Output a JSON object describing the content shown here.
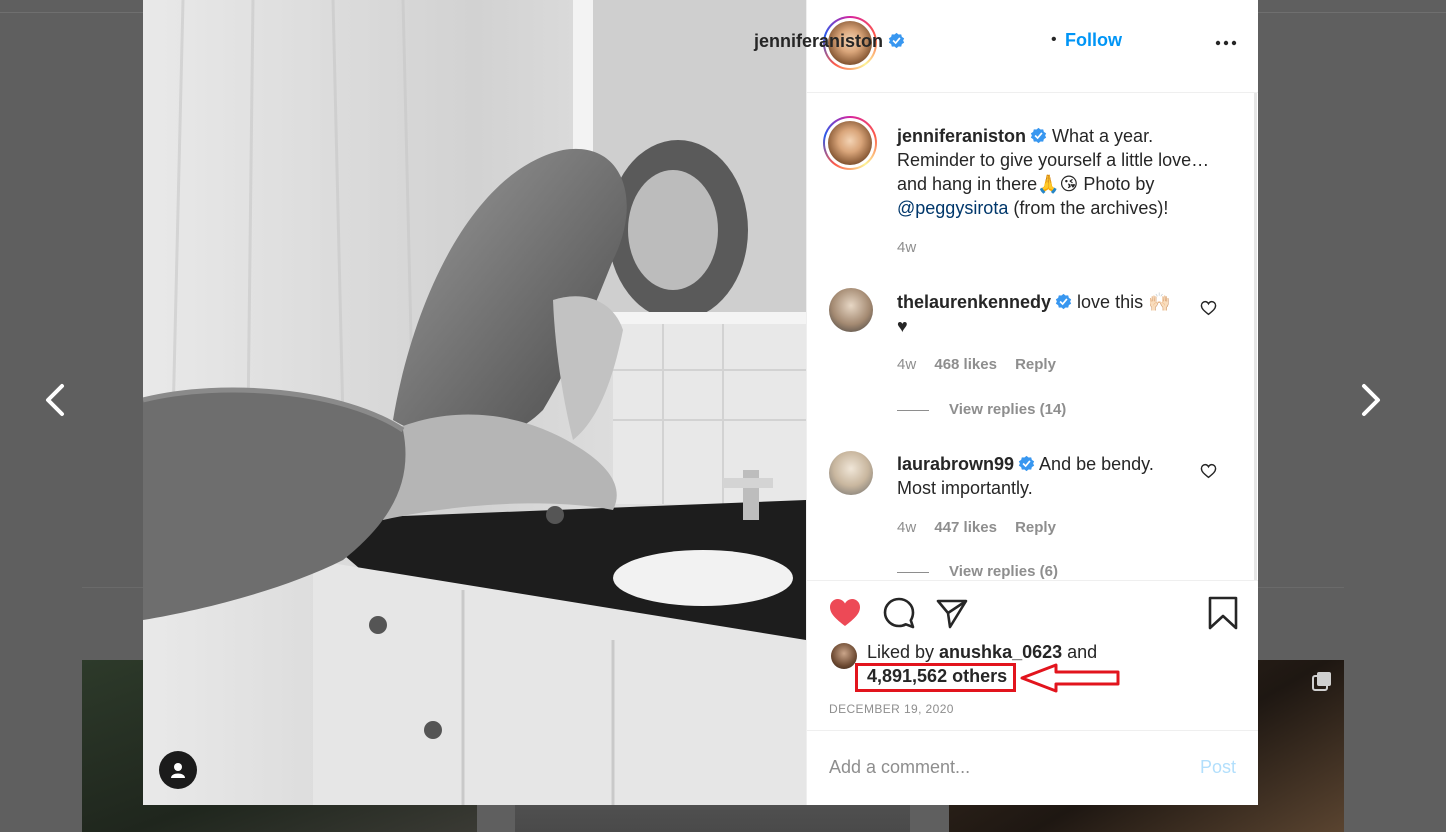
{
  "post": {
    "username": "jenniferaniston",
    "follow_label": "Follow",
    "dot": "•"
  },
  "caption": {
    "username": "jenniferaniston",
    "text_a": " What a year. Reminder to give yourself a little love… and hang in there",
    "emoji": "🙏😘",
    "text_b": " Photo by ",
    "mention": "@peggysirota",
    "text_c": " (from the archives)!",
    "time": "4w"
  },
  "comments": [
    {
      "username": "thelaurenkennedy",
      "text": " love this 🙌🏻 ♥",
      "time": "4w",
      "likes": "468 likes",
      "reply": "Reply",
      "view_replies": "View replies (14)"
    },
    {
      "username": "laurabrown99",
      "text": " And be bendy. Most importantly.",
      "time": "4w",
      "likes": "447 likes",
      "reply": "Reply",
      "view_replies": "View replies (6)"
    }
  ],
  "likes": {
    "prefix": "Liked by ",
    "user": "anushka_0623",
    "and": " and",
    "others": "4,891,562 others"
  },
  "date": "DECEMBER 19, 2020",
  "comment_box": {
    "placeholder": "Add a comment...",
    "post_label": "Post"
  },
  "colors": {
    "accent": "#0095f6",
    "like": "#ed4956",
    "highlight": "#e2141d"
  },
  "icons": [
    "chevron-left-icon",
    "chevron-right-icon",
    "verified-badge-icon",
    "more-options-icon",
    "heart-icon",
    "comment-icon",
    "share-icon",
    "bookmark-icon",
    "user-tag-icon",
    "multiple-photos-icon"
  ]
}
